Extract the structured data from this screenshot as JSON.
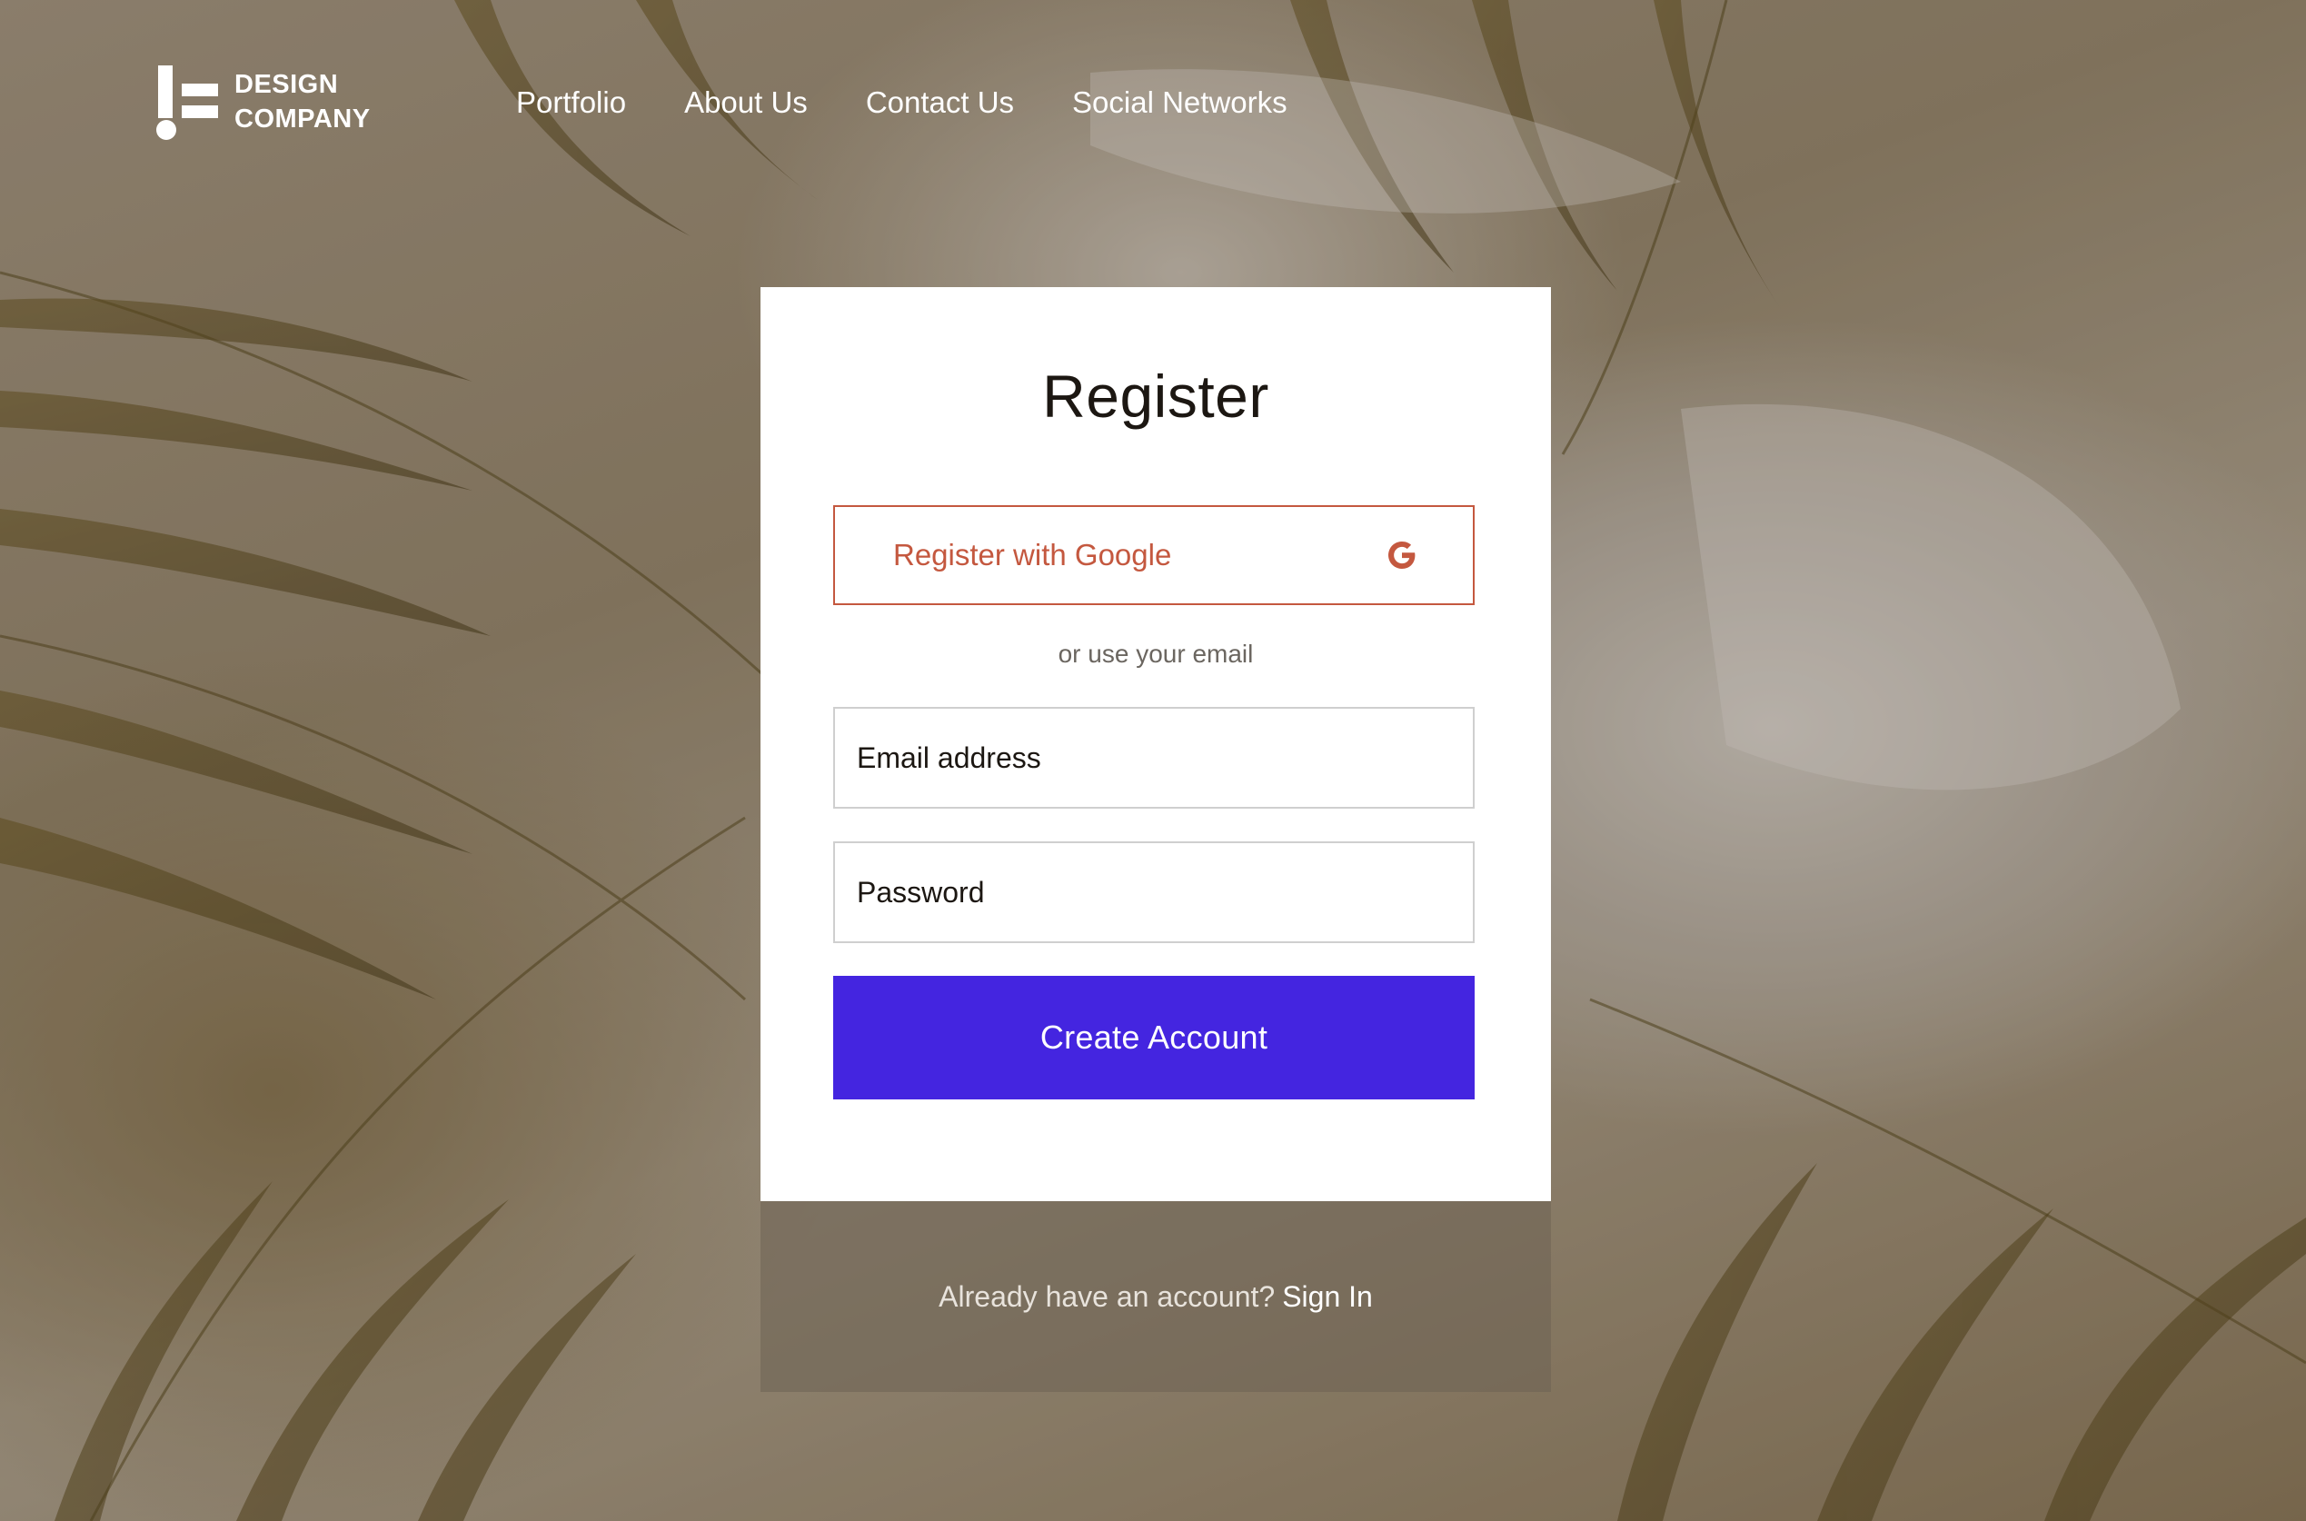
{
  "brand": {
    "line1": "DESIGN",
    "line2": "COMPANY"
  },
  "nav": {
    "items": [
      {
        "label": "Portfolio"
      },
      {
        "label": "About Us"
      },
      {
        "label": "Contact Us"
      },
      {
        "label": "Social Networks"
      }
    ]
  },
  "register": {
    "title": "Register",
    "google_label": "Register with Google",
    "divider": "or use your email",
    "email_placeholder": "Email address",
    "email_value": "",
    "password_placeholder": "Password",
    "password_value": "",
    "submit_label": "Create Account"
  },
  "footer": {
    "prompt": "Already have an account?",
    "signin_label": "Sign In"
  },
  "colors": {
    "accent": "#4425e0",
    "google": "#c4583f",
    "card": "#ffffff"
  },
  "icons": {
    "google": "google-g-icon",
    "logo": "design-company-logo-icon"
  }
}
